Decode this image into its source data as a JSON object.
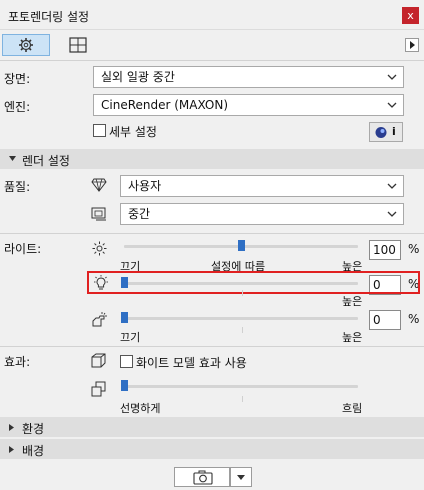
{
  "window": {
    "title": "포토렌더링 설정",
    "close_label": "x"
  },
  "tabs": [
    {
      "name": "settings",
      "icon": "gear-icon",
      "selected": true
    },
    {
      "name": "size",
      "icon": "frame-icon",
      "selected": false
    }
  ],
  "scene": {
    "label": "장면:",
    "value": "실외 일광 중간"
  },
  "engine": {
    "label": "엔진:",
    "value": "CineRender (MAXON)"
  },
  "detail": {
    "label": "세부 설정",
    "checked": false,
    "info_label": "i"
  },
  "render_section": {
    "title": "렌더 설정"
  },
  "quality": {
    "label": "품질:",
    "value1": "사용자",
    "value2": "중간"
  },
  "light": {
    "label": "라이트:",
    "sun": {
      "value": "100",
      "unit": "%",
      "left": "끄기",
      "middle": "설정에 따름",
      "right": "높은",
      "level": 0.5
    },
    "lamp": {
      "value": "0",
      "unit": "%",
      "right": "높은",
      "level": 0
    },
    "env": {
      "value": "0",
      "unit": "%",
      "left": "끄기",
      "right": "높은",
      "level": 0
    }
  },
  "effects": {
    "label": "효과:",
    "white_model": "화이트 모델 효과 사용",
    "white_model_checked": false,
    "blur_left": "선명하게",
    "blur_right": "흐림",
    "blur_level": 0
  },
  "sections": {
    "environment": "환경",
    "background": "배경"
  },
  "accent": "#2f6fc4",
  "highlight": "#e02020"
}
